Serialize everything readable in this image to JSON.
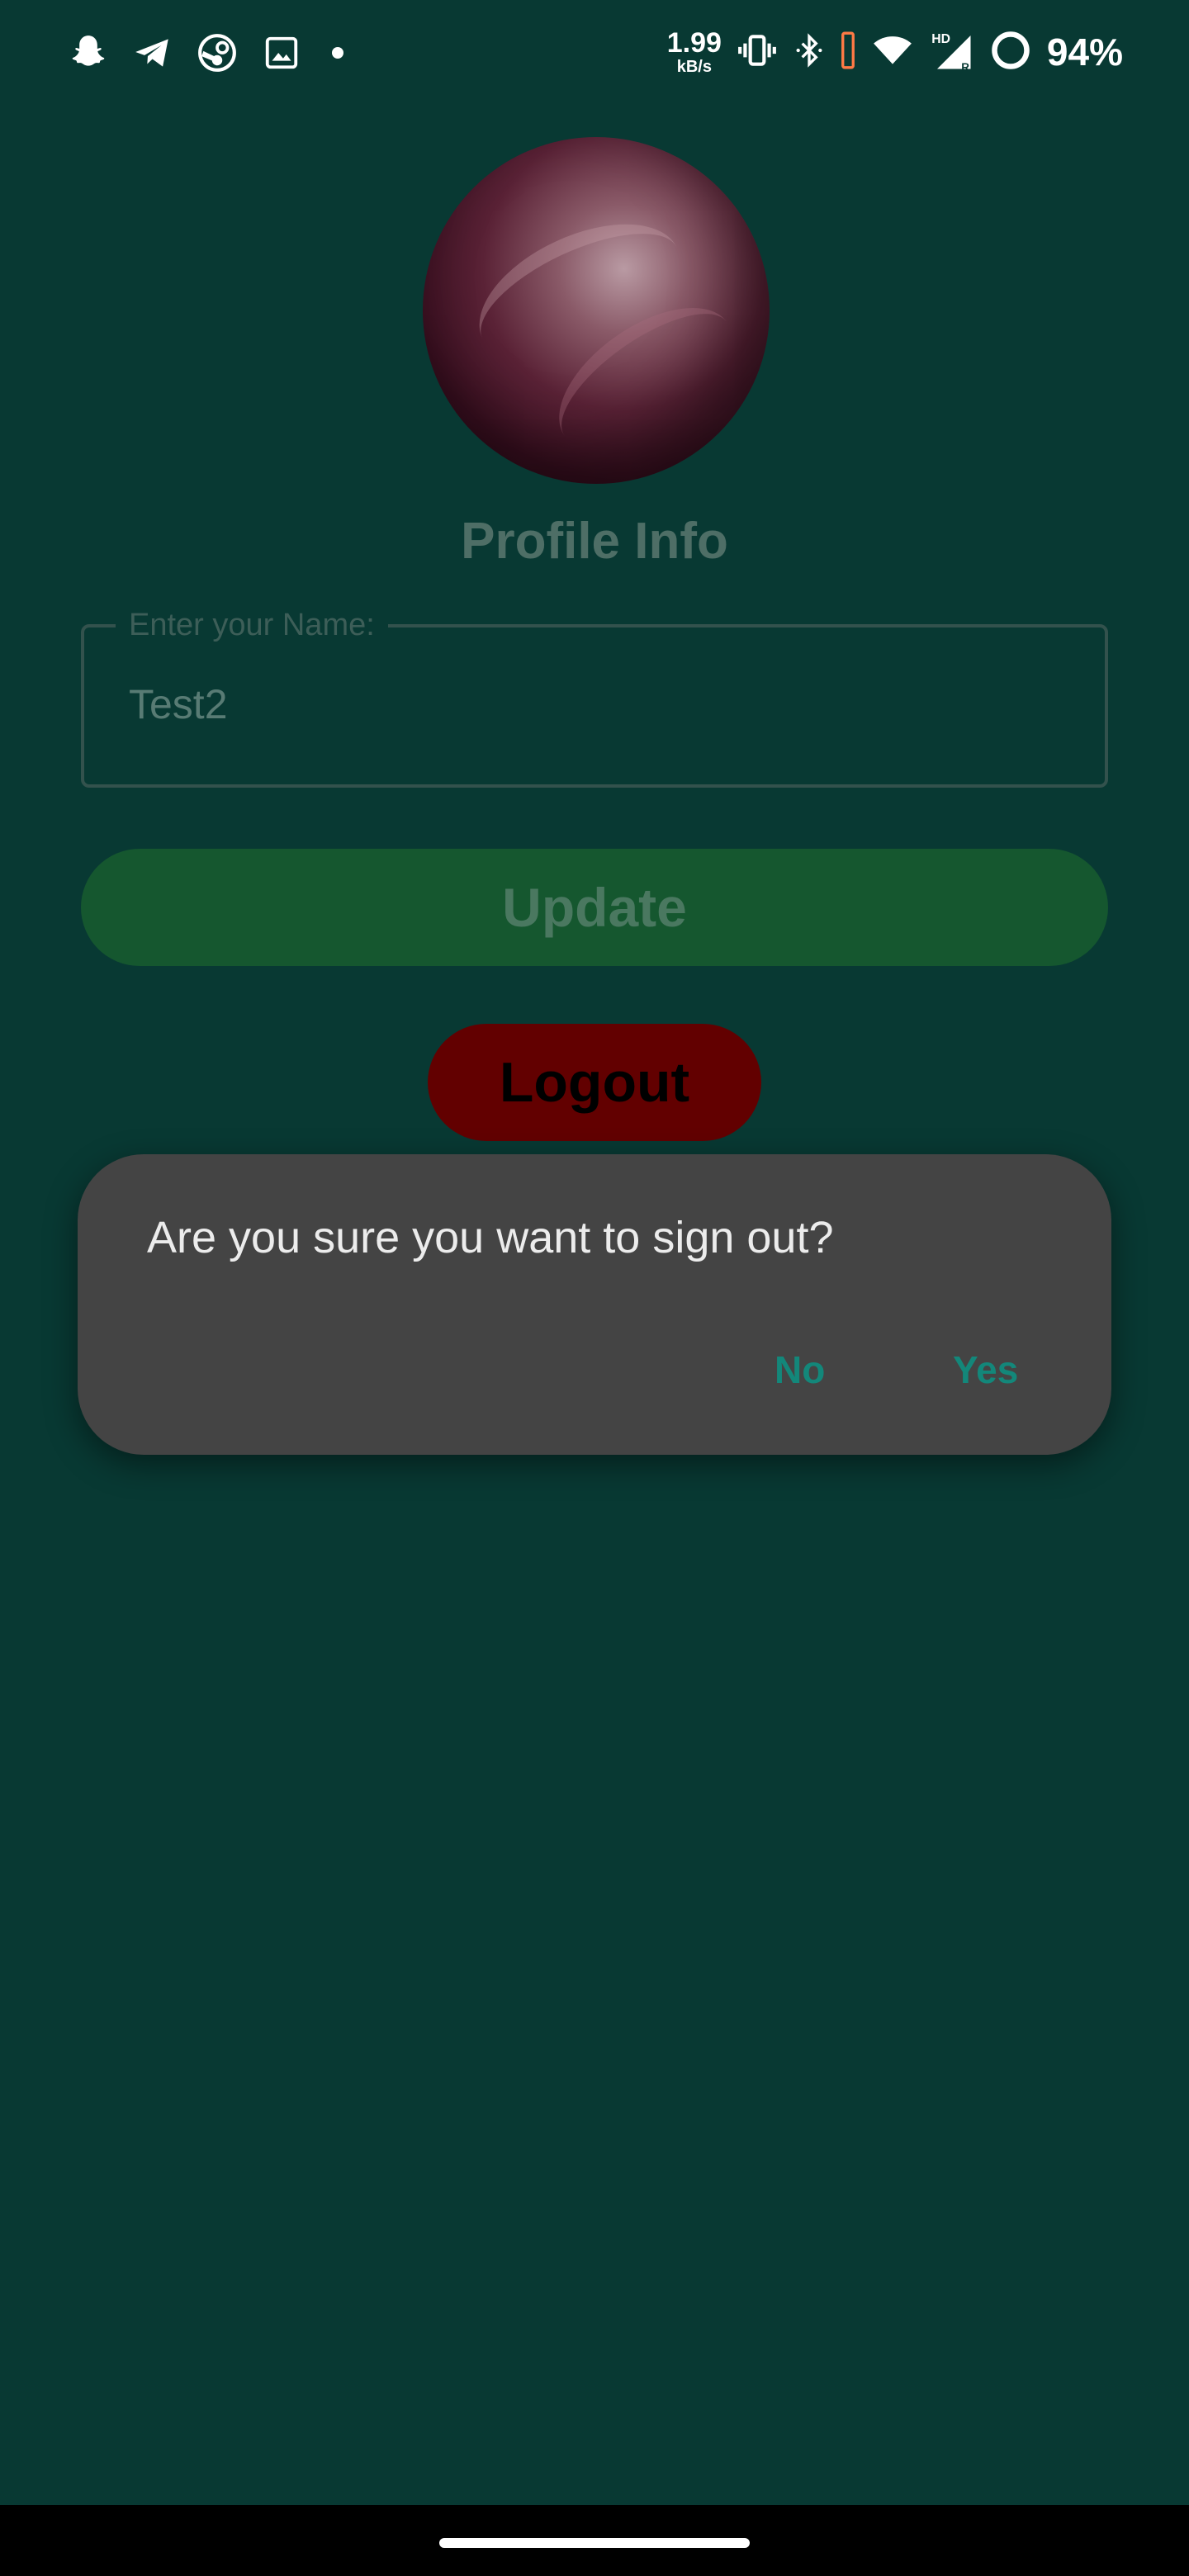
{
  "status_bar": {
    "left_icons": [
      "snapchat-icon",
      "telegram-icon",
      "steam-icon",
      "gallery-icon",
      "notification-dot-icon"
    ],
    "net_speed_value": "1.99",
    "net_speed_unit": "kB/s",
    "right_icons": [
      "vibrate-icon",
      "bluetooth-icon",
      "battery-alert-icon",
      "wifi-icon",
      "signal-hd-icon",
      "battery-ring-icon"
    ],
    "battery_percent": "94%"
  },
  "profile": {
    "title": "Profile Info",
    "name_field_label": "Enter your Name:",
    "name_field_value": "Test2",
    "update_label": "Update",
    "logout_label": "Logout"
  },
  "dialog": {
    "message": "Are you sure you want to sign out?",
    "no_label": "No",
    "yes_label": "Yes"
  },
  "colors": {
    "background": "#083933",
    "update_button": "#15572f",
    "logout_button": "#620000",
    "dialog_bg": "#444444",
    "dialog_action": "#13877a"
  }
}
